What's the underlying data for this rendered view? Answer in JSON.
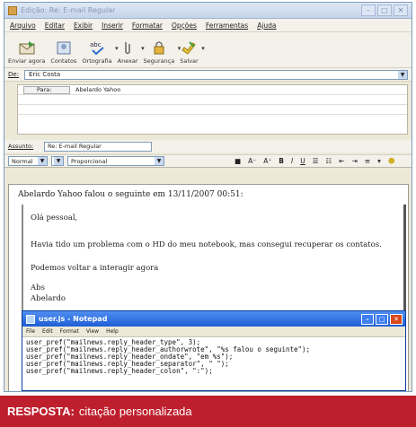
{
  "window": {
    "title": "Edição: Re: E-mail Regular"
  },
  "menu": [
    "Arquivo",
    "Editar",
    "Exibir",
    "Inserir",
    "Formatar",
    "Opções",
    "Ferramentas",
    "Ajuda"
  ],
  "toolbar": [
    {
      "label": "Enviar agora",
      "icon": "send-icon"
    },
    {
      "label": "Contatos",
      "icon": "contacts-icon"
    },
    {
      "label": "Ortografia",
      "icon": "spellcheck-icon"
    },
    {
      "label": "Anexar",
      "icon": "paperclip-icon"
    },
    {
      "label": "Segurança",
      "icon": "lock-icon"
    },
    {
      "label": "Salvar",
      "icon": "save-icon"
    }
  ],
  "from": {
    "label": "De:",
    "value": "Eric Costa"
  },
  "recipients": [
    {
      "type": "Para:",
      "address": "Abelardo Yahoo"
    }
  ],
  "subject": {
    "label": "Assunto:",
    "value": "Re: E-mail Regular"
  },
  "format": {
    "style": "Normal",
    "font": "Proporcional"
  },
  "message": {
    "intro": "Abelardo Yahoo falou o seguinte em 13/11/2007 00:51:",
    "quote": [
      "Olá pessoal,",
      "Havia tido um problema com o HD do meu notebook, mas consegui recuperar os contatos.",
      "Podemos voltar a interagir agora",
      "Abs",
      "Abelardo"
    ]
  },
  "notepad": {
    "title": "user.js - Notepad",
    "menu": [
      "File",
      "Edit",
      "Format",
      "View",
      "Help"
    ],
    "lines": [
      "user_pref(\"mailnews.reply_header_type\", 3);",
      "user_pref(\"mailnews.reply_header_authorwrote\", \"%s falou o seguinte\");",
      "user_pref(\"mailnews.reply_header_ondate\", \"em %s\");",
      "user_pref(\"mailnews.reply_header_separator\", \" \");",
      "user_pref(\"mailnews.reply_header_colon\", \":\");"
    ]
  },
  "caption": {
    "strong": "RESPOSTA:",
    "text": "citação personalizada"
  },
  "colors": {
    "caption_bg": "#be1f2d",
    "notepad_title": "#1e5ed6"
  }
}
